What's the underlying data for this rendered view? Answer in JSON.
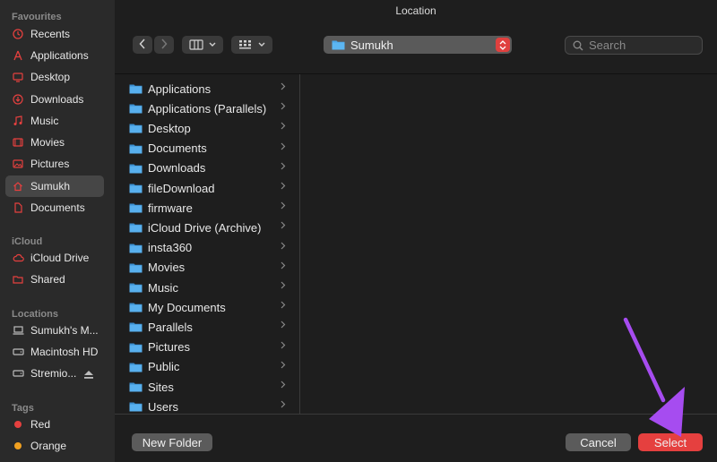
{
  "window": {
    "title": "Location"
  },
  "sidebar": {
    "sections": [
      {
        "label": "Favourites",
        "items": [
          {
            "label": "Recents",
            "icon": "clock-icon"
          },
          {
            "label": "Applications",
            "icon": "applications-icon"
          },
          {
            "label": "Desktop",
            "icon": "desktop-icon"
          },
          {
            "label": "Downloads",
            "icon": "download-icon"
          },
          {
            "label": "Music",
            "icon": "music-note-icon"
          },
          {
            "label": "Movies",
            "icon": "film-icon"
          },
          {
            "label": "Pictures",
            "icon": "photo-icon"
          },
          {
            "label": "Sumukh",
            "icon": "home-icon",
            "selected": true
          },
          {
            "label": "Documents",
            "icon": "document-icon"
          }
        ]
      },
      {
        "label": "iCloud",
        "items": [
          {
            "label": "iCloud Drive",
            "icon": "cloud-icon"
          },
          {
            "label": "Shared",
            "icon": "shared-folder-icon"
          }
        ]
      },
      {
        "label": "Locations",
        "items": [
          {
            "label": "Sumukh's M...",
            "icon": "laptop-icon"
          },
          {
            "label": "Macintosh HD",
            "icon": "disk-icon"
          },
          {
            "label": "Stremio...",
            "icon": "disk-icon"
          }
        ]
      },
      {
        "label": "Tags",
        "items": [
          {
            "label": "Red",
            "icon": "red-tag-icon"
          },
          {
            "label": "Orange",
            "icon": "orange-tag-icon"
          }
        ]
      }
    ]
  },
  "toolbar": {
    "location": "Sumukh",
    "search_placeholder": "Search"
  },
  "files": [
    "Applications",
    "Applications (Parallels)",
    "Desktop",
    "Documents",
    "Downloads",
    "fileDownload",
    "firmware",
    "iCloud Drive (Archive)",
    "insta360",
    "Movies",
    "Music",
    "My Documents",
    "Parallels",
    "Pictures",
    "Public",
    "Sites",
    "Users"
  ],
  "buttons": {
    "new_folder": "New Folder",
    "cancel": "Cancel",
    "select": "Select"
  },
  "colors": {
    "accent": "#e5403f",
    "folder": "#4aa6e8",
    "arrow": "#a64cf0",
    "tag_red": "#e5403f",
    "tag_orange": "#f0a020"
  }
}
